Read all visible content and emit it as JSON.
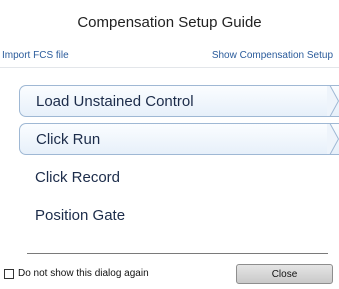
{
  "dialog": {
    "title": "Compensation Setup Guide"
  },
  "links": {
    "import_fcs": "Import FCS file",
    "show_compensation": "Show Compensation Setup"
  },
  "steps": [
    {
      "label": "Load Unstained Control",
      "state": "active"
    },
    {
      "label": "Click Run",
      "state": "active"
    },
    {
      "label": "Click Record",
      "state": "inactive"
    },
    {
      "label": "Position Gate",
      "state": "inactive"
    }
  ],
  "footer": {
    "checkbox_label": "Do not show this dialog again",
    "checkbox_checked": false,
    "close_label": "Close"
  },
  "colors": {
    "link": "#2a5b9b",
    "step_text": "#1c2c4a",
    "active_border": "#9fb8d4"
  }
}
